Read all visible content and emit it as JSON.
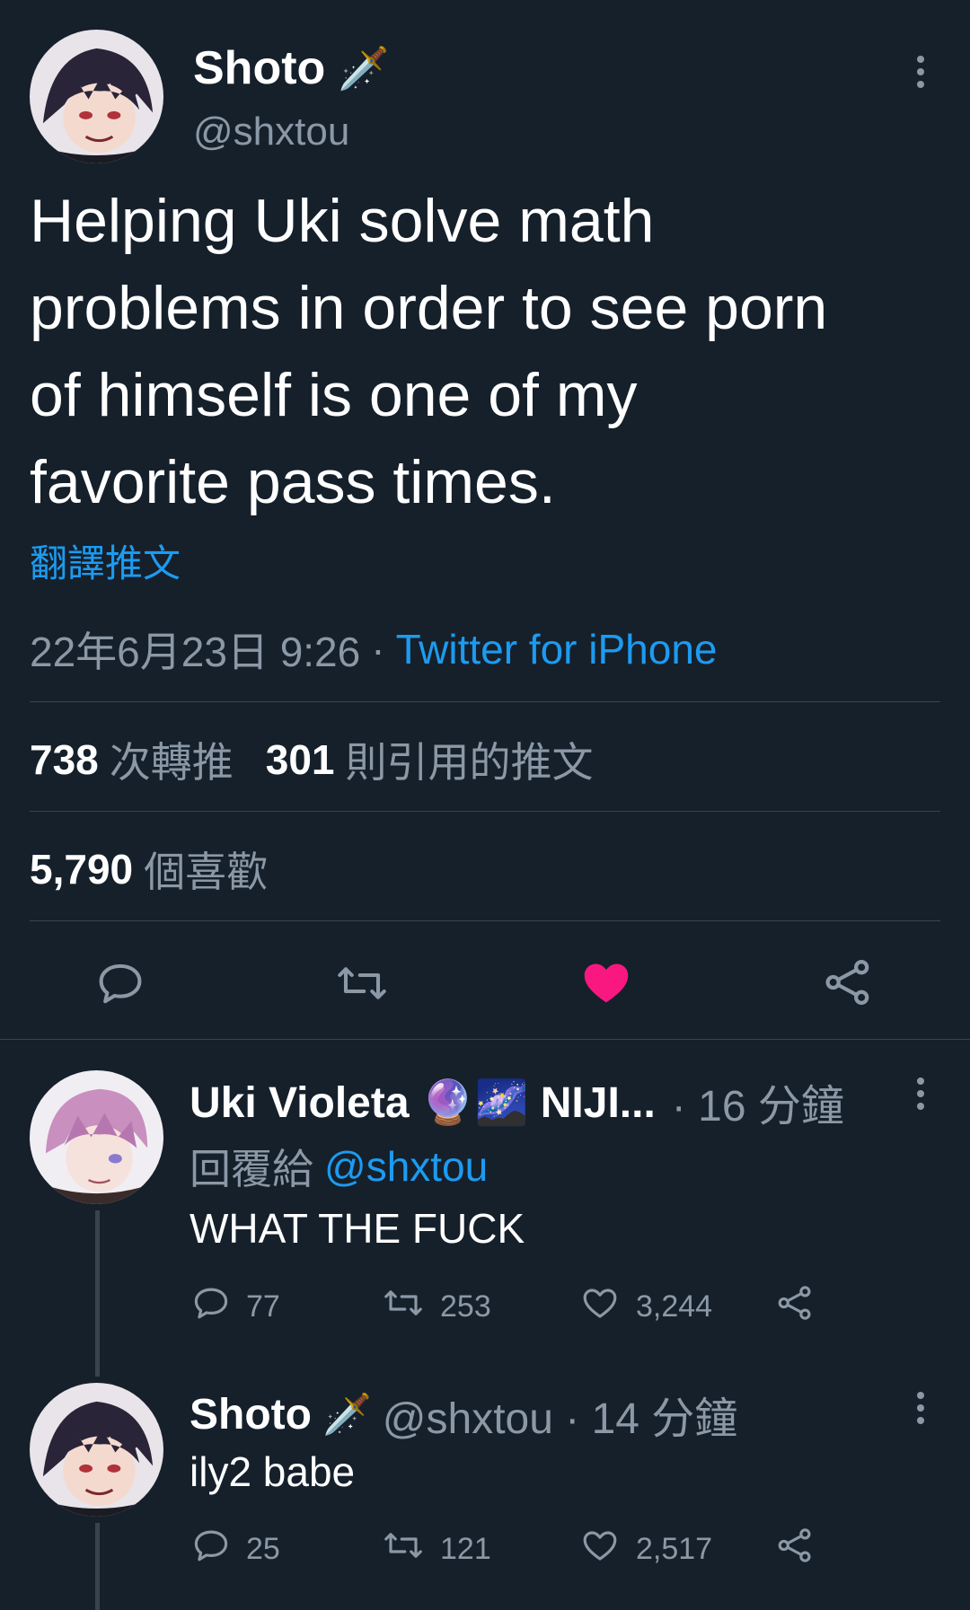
{
  "main_tweet": {
    "display_name": "Shoto",
    "name_emoji": "🗡️",
    "handle": "@shxtou",
    "text_lines": [
      "Helping Uki solve math",
      "problems in order to see porn",
      "of himself is one of my",
      "favorite pass times."
    ],
    "translate_link": "翻譯推文",
    "timestamp": "22年6月23日 9:26",
    "separator": "·",
    "source": "Twitter for iPhone",
    "retweets_count": "738",
    "retweets_label": "次轉推",
    "quotes_count": "301",
    "quotes_label": "則引用的推文",
    "likes_count": "5,790",
    "likes_label": "個喜歡",
    "liked": true
  },
  "replies": [
    {
      "display_name": "Uki Violeta 🔮🌌 NIJI...",
      "time": "· 16 分鐘",
      "reply_to_label": "回覆給",
      "reply_to_handle": "@shxtou",
      "text": "WHAT THE FUCK",
      "reply_count": "77",
      "retweet_count": "253",
      "like_count": "3,244"
    },
    {
      "display_name": "Shoto",
      "name_emoji": "🗡️",
      "handle_time": "@shxtou · 14 分鐘",
      "text": "ily2 babe",
      "reply_count": "25",
      "retweet_count": "121",
      "like_count": "2,517"
    }
  ],
  "colors": {
    "background": "#15202b",
    "accent": "#1d9bf0",
    "like": "#f91880",
    "muted": "#8b98a5",
    "divider": "#38444d"
  }
}
